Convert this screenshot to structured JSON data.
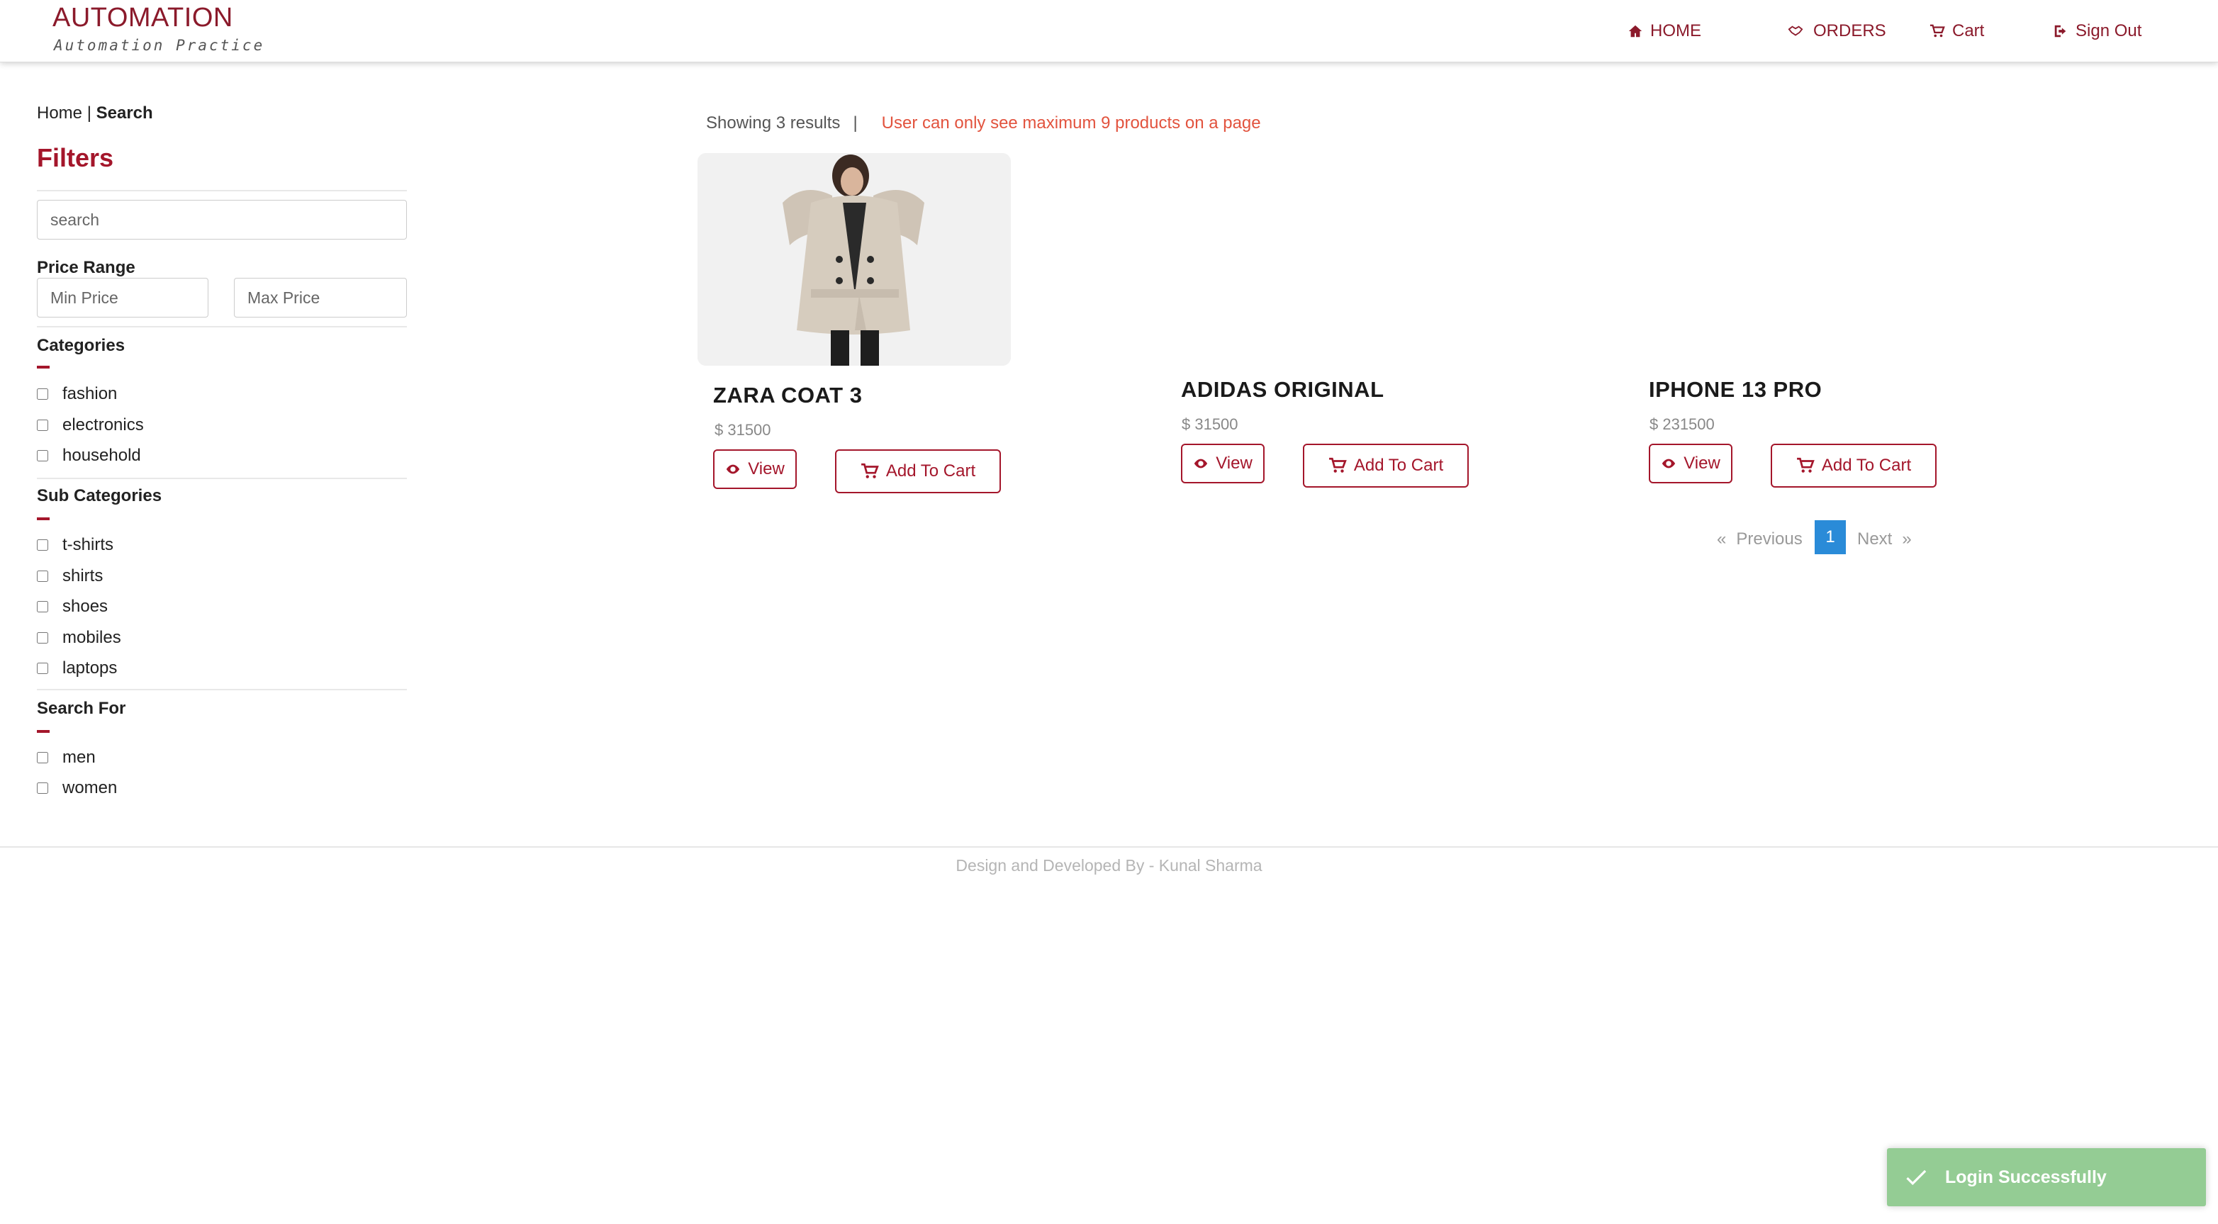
{
  "brand": {
    "title": "AUTOMATION",
    "subtitle": "Automation Practice"
  },
  "nav": {
    "home": "HOME",
    "orders": "ORDERS",
    "cart": "Cart",
    "signout": "Sign Out"
  },
  "breadcrumb": {
    "home": "Home",
    "sep": "|",
    "current": "Search"
  },
  "filters": {
    "title": "Filters",
    "search_placeholder": "search",
    "price_range_label": "Price Range",
    "min_placeholder": "Min Price",
    "max_placeholder": "Max Price",
    "categories_label": "Categories",
    "categories": [
      "fashion",
      "electronics",
      "household"
    ],
    "subcategories_label": "Sub Categories",
    "subcategories": [
      "t-shirts",
      "shirts",
      "shoes",
      "mobiles",
      "laptops"
    ],
    "searchfor_label": "Search For",
    "searchfor": [
      "men",
      "women"
    ]
  },
  "results": {
    "showing": "Showing 3 results",
    "sep": "|",
    "warning": "User can only see maximum 9 products on a page"
  },
  "products": [
    {
      "name": "ZARA COAT 3",
      "price": "$ 31500",
      "view": "View",
      "add": "Add To Cart"
    },
    {
      "name": "ADIDAS ORIGINAL",
      "price": "$ 31500",
      "view": "View",
      "add": "Add To Cart"
    },
    {
      "name": "IPHONE 13 PRO",
      "price": "$ 231500",
      "view": "View",
      "add": "Add To Cart"
    }
  ],
  "pagination": {
    "prev_arrow": "«",
    "prev": "Previous",
    "current": "1",
    "next": "Next",
    "next_arrow": "»"
  },
  "footer": {
    "text": "Design and Developed By - Kunal Sharma"
  },
  "toast": {
    "message": "Login Successfully"
  },
  "colors": {
    "brand": "#8b1a2b",
    "accent": "#a4162b",
    "warning": "#e2533e",
    "active_page": "#2a8bd8",
    "toast": "#94cc94"
  },
  "icons": {
    "home": "home-icon",
    "orders": "handshake-icon",
    "cart": "cart-icon",
    "signout": "sign-out-icon",
    "view": "eye-icon",
    "toast": "check-icon"
  }
}
